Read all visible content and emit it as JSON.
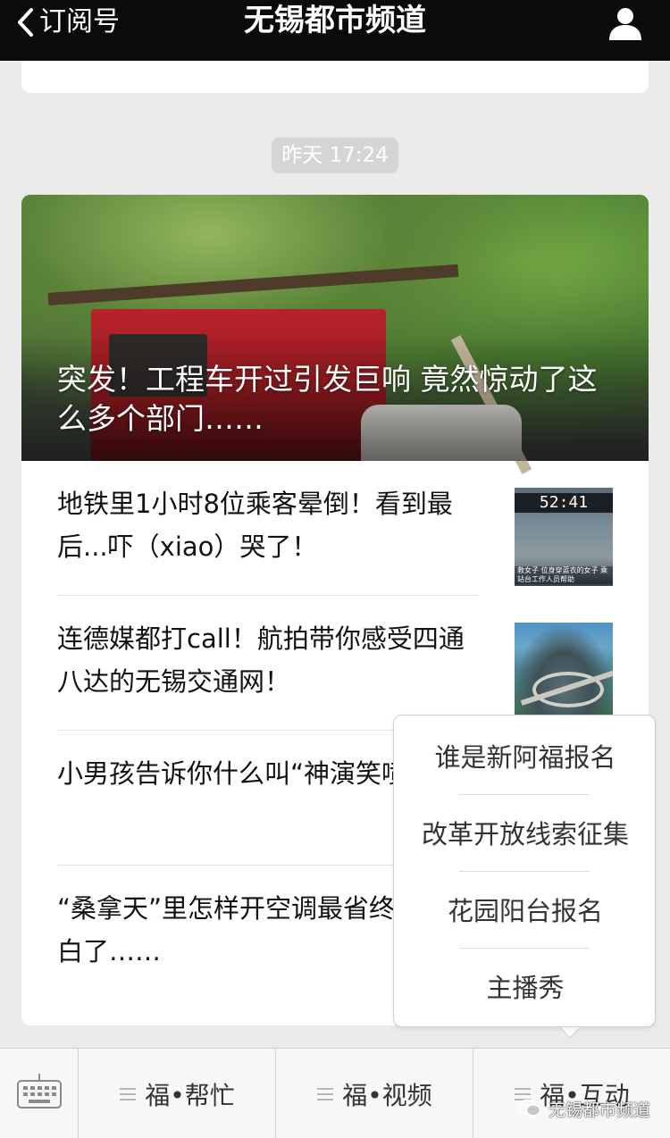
{
  "nav": {
    "back_label": "订阅号",
    "title": "无锡都市频道",
    "profile_icon": "person-icon"
  },
  "timestamp": "昨天 17:24",
  "hero": {
    "title": "突发！工程车开过引发巨响 竟然惊动了这么多个部门……"
  },
  "articles": [
    {
      "title": "地铁里1小时8位乘客晕倒！看到最后...吓（xiao）哭了！",
      "thumb_clock": "52:41",
      "thumb_caption": "救女子 位身穿蓝衣的女子 乘站台工作人员帮助"
    },
    {
      "title": "连德媒都打call！航拍带你感受四通八达的无锡交通网！"
    },
    {
      "title": "小男孩告诉你什么叫“神演笑喷了……"
    },
    {
      "title": "“桑拿天”里怎样开空调最省终于搞明白了……"
    }
  ],
  "popup_menu": {
    "items": [
      "谁是新阿福报名",
      "改革开放线索征集",
      "花园阳台报名",
      "主播秀"
    ]
  },
  "bottom_menu": {
    "keyboard_icon": "keyboard-icon",
    "tabs": [
      "福•帮忙",
      "福•视频",
      "福•互动"
    ]
  },
  "watermark": {
    "text": "无锡都市频道",
    "icon": "wechat-icon"
  },
  "colors": {
    "nav_bg": "#0b0b0b",
    "page_bg": "#ebebeb",
    "badge_bg": "#d5d5d5"
  }
}
